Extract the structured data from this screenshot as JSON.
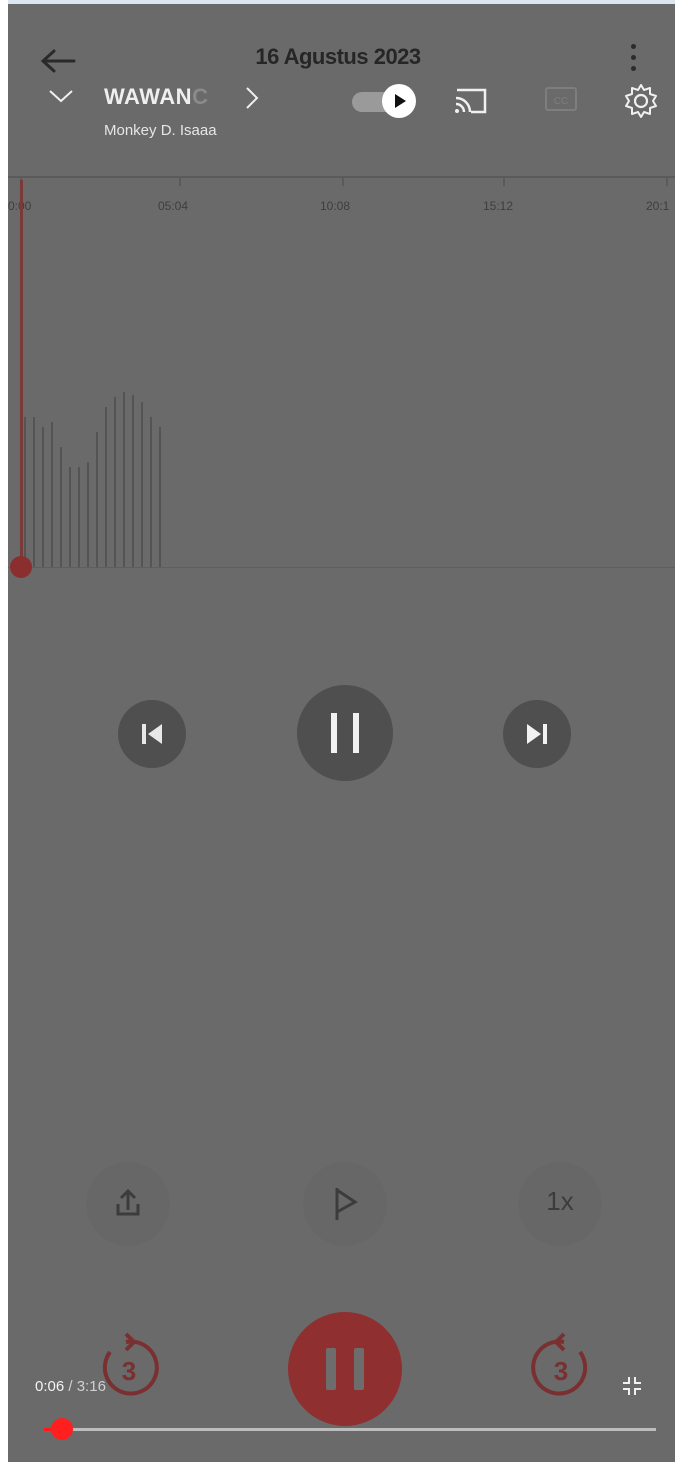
{
  "recorder": {
    "date": "16 Agustus 2023",
    "ruler_ticks": [
      "0:00",
      "05:04",
      "10:08",
      "15:12",
      "20:1"
    ],
    "speed_label": "1x",
    "skip_back_seconds": "3",
    "skip_forward_seconds": "3"
  },
  "player": {
    "title_visible": "WAWAN",
    "title_fade": "C",
    "channel": "Monkey D. Isaaa",
    "current_time": "0:06",
    "separator": " / ",
    "duration": "3:16",
    "progress_fraction": 0.03,
    "autoplay_on": true
  },
  "colors": {
    "accent_red": "#ff1a1a",
    "overlay": "#6a6a6a"
  },
  "icons": [
    "back-arrow-icon",
    "more-vert-icon",
    "chevron-down-icon",
    "chevron-right-icon",
    "autoplay-toggle-icon",
    "cast-icon",
    "closed-captions-icon",
    "settings-gear-icon",
    "skip-previous-icon",
    "pause-icon",
    "skip-next-icon",
    "share-icon",
    "flag-icon",
    "replay-3-icon",
    "forward-3-icon",
    "exit-fullscreen-icon"
  ]
}
